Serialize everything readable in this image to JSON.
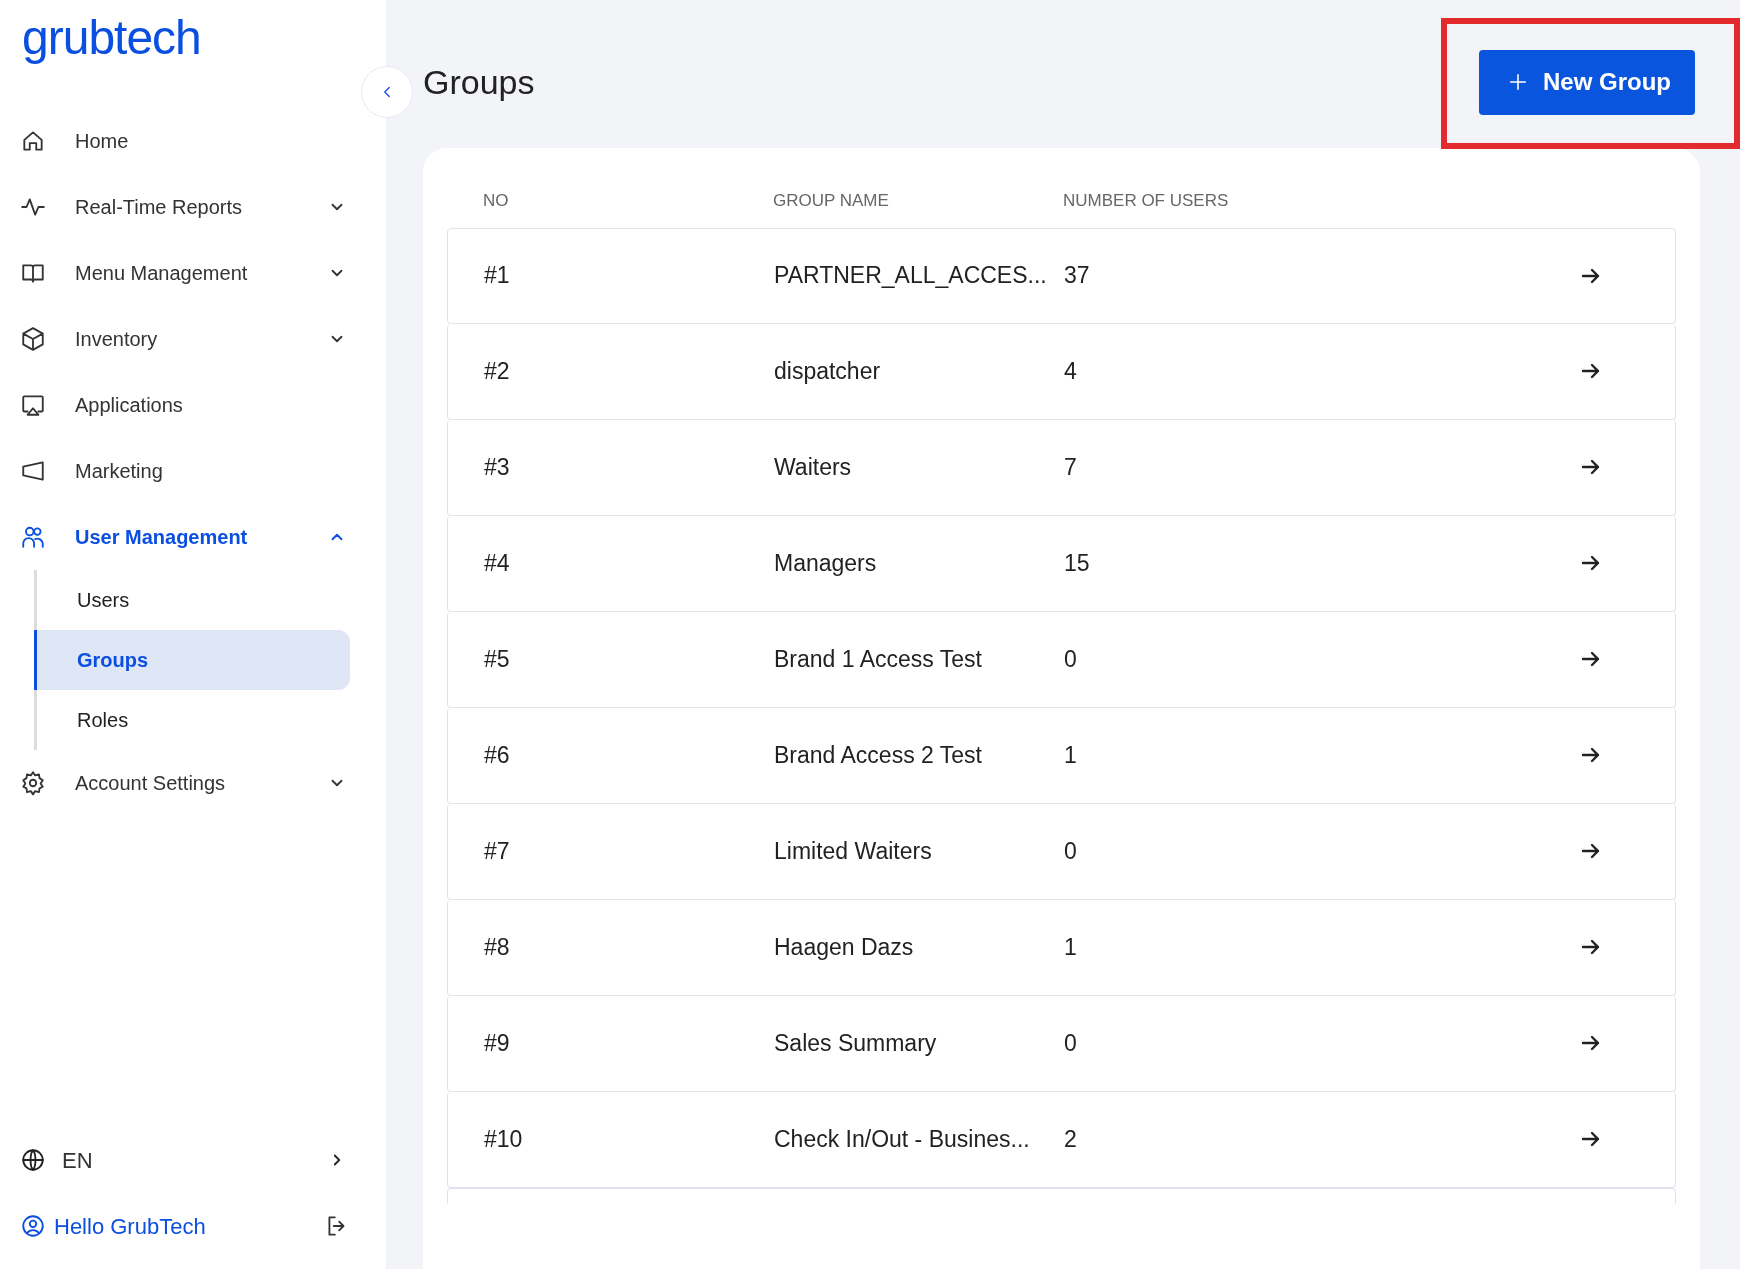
{
  "logo": {
    "text": "grubtech"
  },
  "sidebar": {
    "items": [
      {
        "kind": "link",
        "label": "Home",
        "selected": false
      },
      {
        "kind": "group",
        "label": "Real-Time Reports",
        "selected": false,
        "expanded": false
      },
      {
        "kind": "group",
        "label": "Menu Management",
        "selected": false,
        "expanded": false
      },
      {
        "kind": "group",
        "label": "Inventory",
        "selected": false,
        "expanded": false
      },
      {
        "kind": "link",
        "label": "Applications",
        "selected": false
      },
      {
        "kind": "link",
        "label": "Marketing",
        "selected": false
      },
      {
        "kind": "group",
        "label": "User Management",
        "selected": true,
        "expanded": true,
        "children": [
          {
            "label": "Users",
            "selected": false
          },
          {
            "label": "Groups",
            "selected": true
          },
          {
            "label": "Roles",
            "selected": false
          }
        ]
      },
      {
        "kind": "group",
        "label": "Account Settings",
        "selected": false,
        "expanded": false
      }
    ],
    "language": "EN",
    "user": "Hello GrubTech"
  },
  "page": {
    "title": "Groups",
    "new_button": "New Group"
  },
  "table": {
    "columns": [
      "NO",
      "GROUP NAME",
      "NUMBER OF USERS"
    ],
    "rows": [
      {
        "no": "#1",
        "name": "PARTNER_ALL_ACCES...",
        "users": "37"
      },
      {
        "no": "#2",
        "name": "dispatcher",
        "users": "4"
      },
      {
        "no": "#3",
        "name": "Waiters",
        "users": "7"
      },
      {
        "no": "#4",
        "name": "Managers",
        "users": "15"
      },
      {
        "no": "#5",
        "name": "Brand 1 Access Test",
        "users": "0"
      },
      {
        "no": "#6",
        "name": "Brand Access 2 Test",
        "users": "1"
      },
      {
        "no": "#7",
        "name": "Limited Waiters",
        "users": "0"
      },
      {
        "no": "#8",
        "name": "Haagen Dazs",
        "users": "1"
      },
      {
        "no": "#9",
        "name": "Sales Summary",
        "users": "0"
      },
      {
        "no": "#10",
        "name": "Check In/Out - Busines...",
        "users": "2"
      }
    ]
  }
}
